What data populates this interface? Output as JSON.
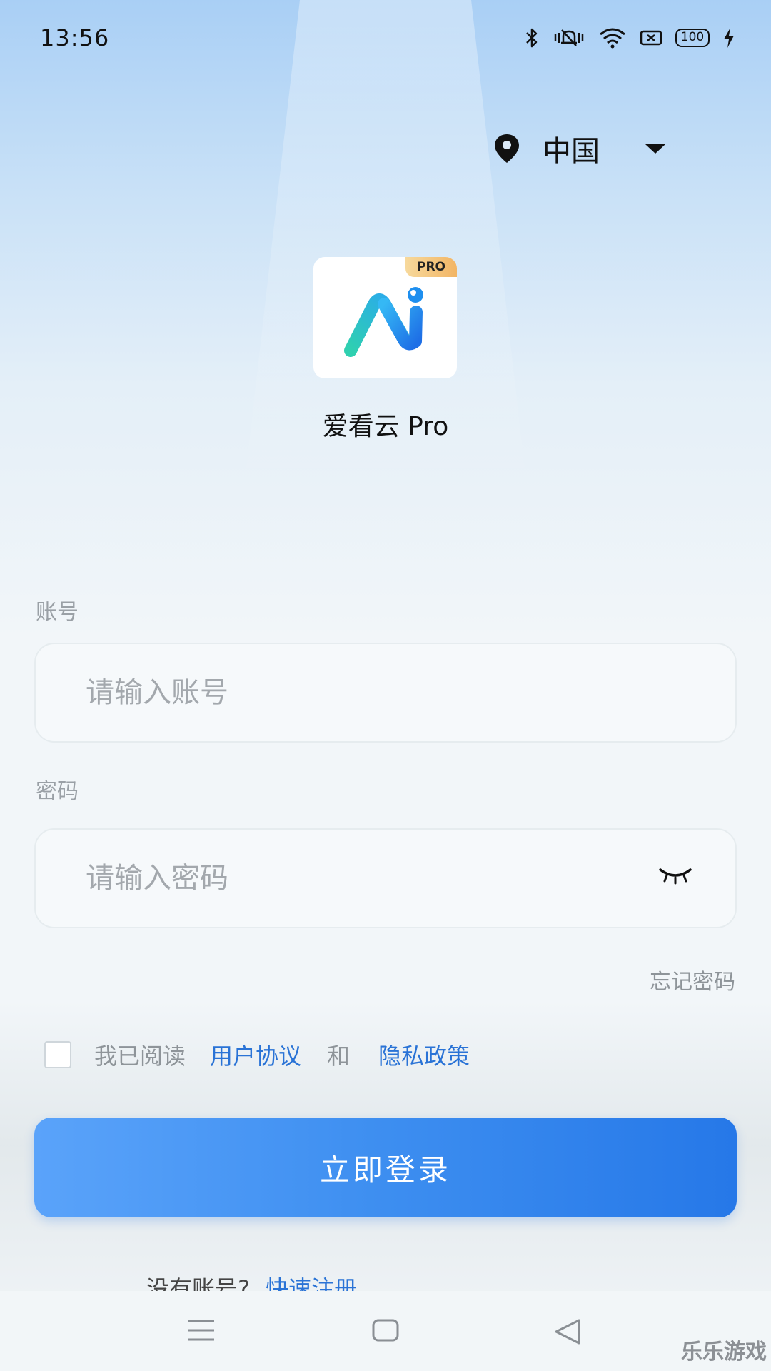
{
  "status_bar": {
    "time": "13:56",
    "battery": "100",
    "icons": [
      "bluetooth-icon",
      "mute-vibrate-icon",
      "wifi-icon",
      "sim-icon",
      "battery-icon",
      "charging-icon"
    ]
  },
  "region": {
    "label": "中国",
    "icon": "location-pin-icon"
  },
  "app": {
    "name": "爱看云 Pro",
    "badge": "PRO"
  },
  "form": {
    "account_label": "账号",
    "account_placeholder": "请输入账号",
    "password_label": "密码",
    "password_placeholder": "请输入密码",
    "forgot_password": "忘记密码"
  },
  "agreement": {
    "prefix": "我已阅读",
    "user_agreement": "用户协议",
    "and": "和",
    "privacy_policy": "隐私政策"
  },
  "login_button": "立即登录",
  "register": {
    "prompt": "没有账号?",
    "link": "快速注册"
  },
  "watermark": "乐乐游戏",
  "colors": {
    "accent": "#2a73d6",
    "button_start": "#5aa3fa",
    "button_end": "#2678e8"
  }
}
